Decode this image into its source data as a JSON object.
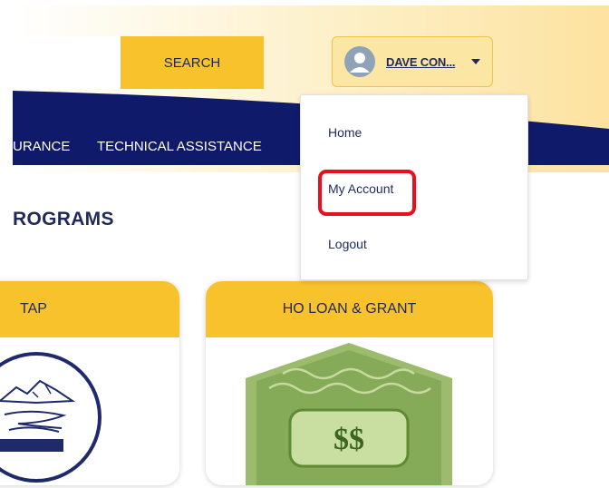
{
  "header": {
    "search_button_label": "SEARCH",
    "user_name": "DAVE CON...",
    "colors": {
      "accent": "#f8c22d",
      "navy": "#0f1a6b",
      "cream": "#fdeebd"
    }
  },
  "nav": {
    "items": [
      {
        "label": "URANCE"
      },
      {
        "label": "TECHNICAL ASSISTANCE"
      }
    ]
  },
  "user_menu": {
    "items": [
      {
        "label": "Home"
      },
      {
        "label": "My Account"
      },
      {
        "label": "Logout"
      }
    ],
    "highlighted": "My Account",
    "highlight_color": "#e8101d"
  },
  "section": {
    "title": "ROGRAMS"
  },
  "cards": [
    {
      "title": "TAP"
    },
    {
      "title": "HO LOAN & GRANT",
      "icon_text": "$$"
    }
  ]
}
